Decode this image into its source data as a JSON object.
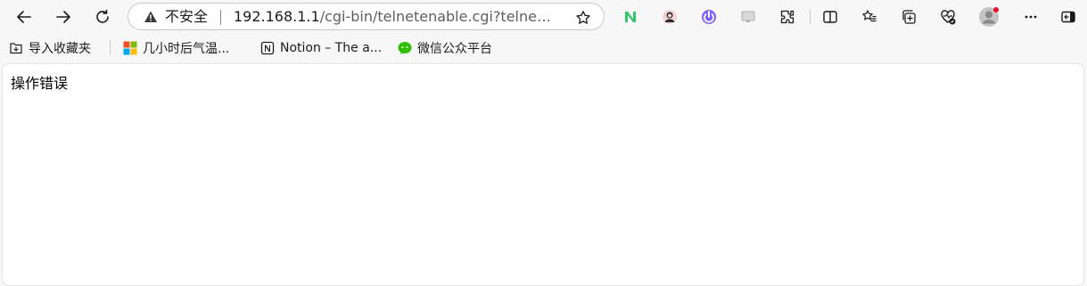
{
  "address_bar": {
    "security_label": "不安全",
    "url_host": "192.168.1.1",
    "url_path": "/cgi-bin/telnetenable.cgi?telnet…"
  },
  "bookmarks": [
    {
      "label": "导入收藏夹",
      "icon": "import-favorites-icon"
    },
    {
      "label": "几小时后气温...",
      "icon": "windows-logo-icon"
    },
    {
      "label": "Notion – The a...",
      "icon": "notion-logo-icon"
    },
    {
      "label": "微信公众平台",
      "icon": "wechat-logo-icon"
    }
  ],
  "page": {
    "message": "操作错误"
  },
  "colors": {
    "accent": "#3c78d8",
    "notification_dot": "#e81123",
    "page_background": "#ffffff",
    "chrome_background": "#f7f7f7"
  }
}
